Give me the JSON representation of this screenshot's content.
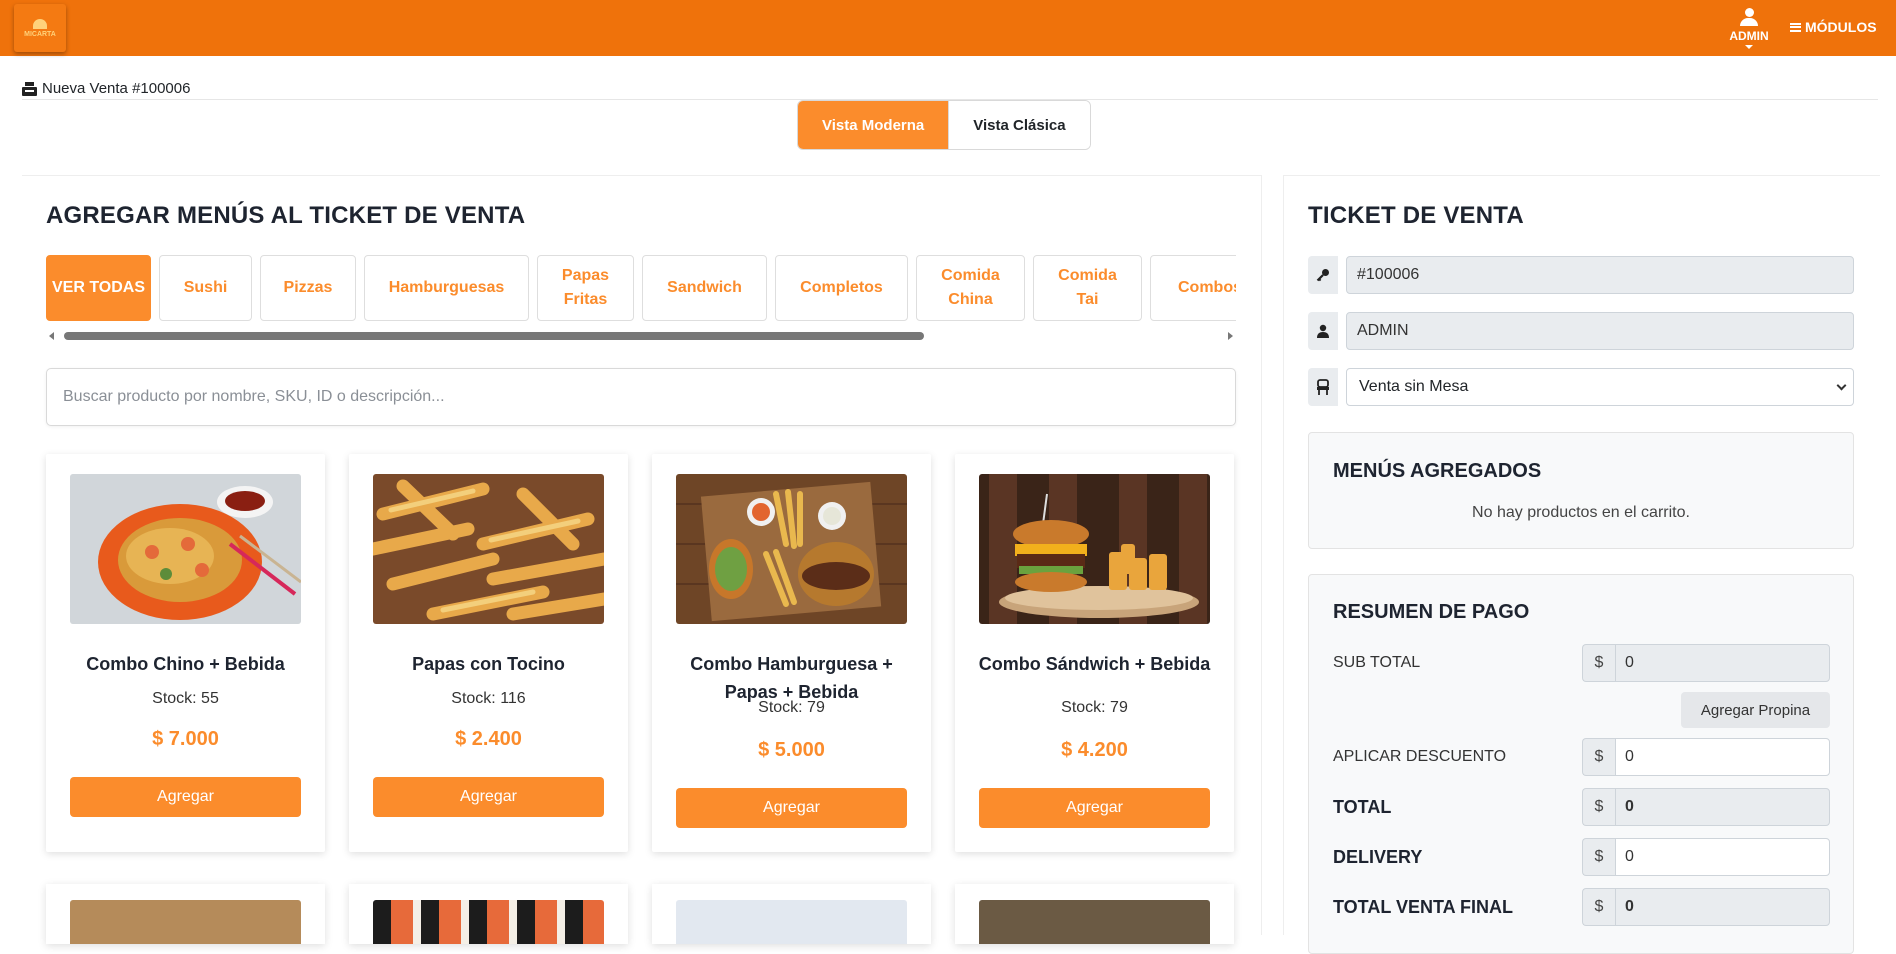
{
  "header": {
    "logo_text": "MICARTA",
    "user_label": "ADMIN",
    "modules_label": "MÓDULOS",
    "brand_color": "#ef720b"
  },
  "breadcrumb": {
    "title": "Nueva Venta #100006"
  },
  "view_toggle": {
    "modern": "Vista Moderna",
    "classic": "Vista Clásica"
  },
  "menu_panel": {
    "title": "AGREGAR MENÚS AL TICKET DE VENTA",
    "categories": [
      "VER TODAS",
      "Sushi",
      "Pizzas",
      "Hamburguesas",
      "Papas Fritas",
      "Sandwich",
      "Completos",
      "Comida China",
      "Comida Tai",
      "Combos"
    ],
    "search_placeholder": "Buscar producto por nombre, SKU, ID o descripción...",
    "products": [
      {
        "name": "Combo Chino + Bebida",
        "stock": "Stock: 55",
        "price": "$ 7.000",
        "button": "Agregar"
      },
      {
        "name": "Papas con Tocino",
        "stock": "Stock: 116",
        "price": "$ 2.400",
        "button": "Agregar"
      },
      {
        "name": "Combo Hamburguesa + Papas + Bebida",
        "stock": "Stock: 79",
        "price": "$ 5.000",
        "button": "Agregar"
      },
      {
        "name": "Combo Sándwich + Bebida",
        "stock": "Stock: 79",
        "price": "$ 4.200",
        "button": "Agregar"
      }
    ]
  },
  "ticket": {
    "title": "TICKET DE VENTA",
    "ticket_id": "#100006",
    "user": "ADMIN",
    "table_select": "Venta sin Mesa",
    "added_title": "MENÚS AGREGADOS",
    "empty_cart": "No hay productos en el carrito.",
    "summary": {
      "title": "RESUMEN DE PAGO",
      "currency": "$",
      "subtotal_label": "SUB TOTAL",
      "subtotal_value": "0",
      "tip_button": "Agregar Propina",
      "discount_label": "APLICAR DESCUENTO",
      "discount_value": "0",
      "total_label": "TOTAL",
      "total_value": "0",
      "delivery_label": "DELIVERY",
      "delivery_value": "0",
      "final_label": "TOTAL VENTA FINAL",
      "final_value": "0"
    }
  },
  "colors": {
    "accent": "#fb8c2c",
    "topbar": "#ef720b"
  }
}
